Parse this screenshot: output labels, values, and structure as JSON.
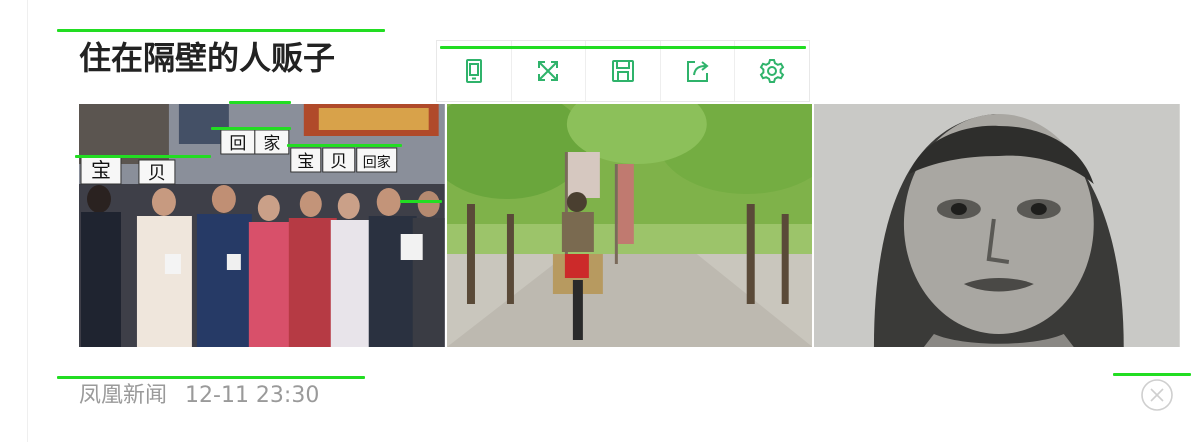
{
  "article": {
    "title": "住在隔壁的人贩子",
    "source": "凤凰新闻",
    "time": "12-11 23:30"
  },
  "toolbar": {
    "buttons": [
      {
        "icon": "tablet-icon"
      },
      {
        "icon": "expand-icon"
      },
      {
        "icon": "save-icon"
      },
      {
        "icon": "share-icon"
      },
      {
        "icon": "gear-icon"
      }
    ],
    "accent_color": "#2fb36b"
  },
  "images": {
    "photo1_signs": [
      "宝",
      "贝",
      "回",
      "家",
      "宝",
      "贝",
      "回家"
    ]
  },
  "colors": {
    "title": "#222222",
    "meta": "#9a9a9a",
    "highlight": "#22dd22"
  }
}
